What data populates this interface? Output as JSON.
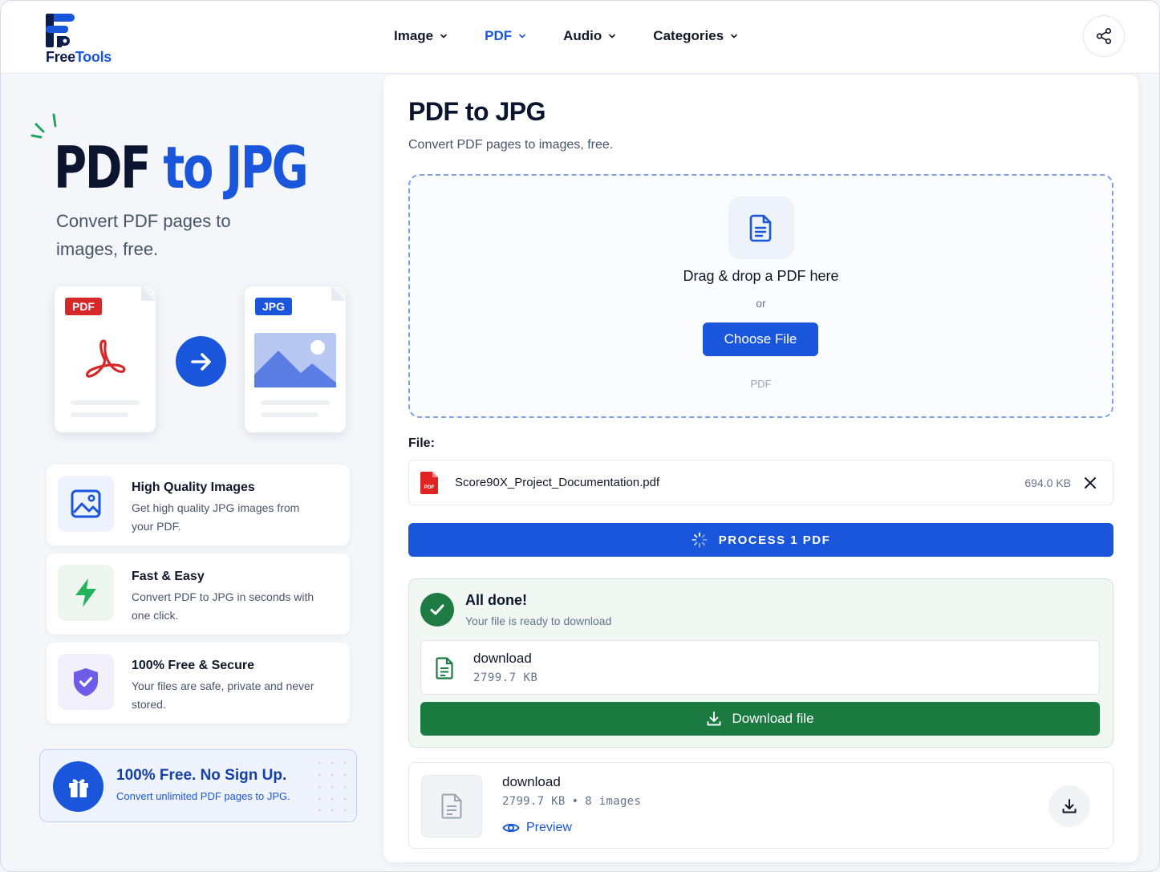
{
  "brand": {
    "name_part1": "Free",
    "name_part2": "Tools",
    "accent": "#1a56db"
  },
  "nav": {
    "items": [
      {
        "label": "Image",
        "active": false
      },
      {
        "label": "PDF",
        "active": true
      },
      {
        "label": "Audio",
        "active": false
      },
      {
        "label": "Categories",
        "active": false
      }
    ],
    "share_icon": "share-icon"
  },
  "hero": {
    "title_part1": "PDF",
    "title_part2": "to JPG",
    "subtitle": "Convert PDF pages to images, free.",
    "from_badge": "PDF",
    "to_badge": "JPG"
  },
  "features": [
    {
      "title": "High Quality Images",
      "desc": "Get high quality JPG images from your PDF.",
      "icon": "image-icon"
    },
    {
      "title": "Fast & Easy",
      "desc": "Convert PDF to JPG in seconds with one click.",
      "icon": "lightning-icon"
    },
    {
      "title": "100% Free & Secure",
      "desc": "Your files are safe, private and never stored.",
      "icon": "shield-icon"
    }
  ],
  "promo": {
    "title": "100% Free. No Sign Up.",
    "desc": "Convert unlimited PDF pages to JPG."
  },
  "tool": {
    "title": "PDF to JPG",
    "subtitle": "Convert PDF pages to images, free.",
    "dropzone": {
      "text": "Drag & drop a PDF here",
      "or": "or",
      "button": "Choose File",
      "accepted": "PDF"
    },
    "file_label": "File:",
    "file": {
      "name": "Score90X_Project_Documentation.pdf",
      "size": "694.0 KB"
    },
    "process_button": "PROCESS 1 PDF",
    "done": {
      "title": "All done!",
      "subtitle": "Your file is ready to download",
      "file_name": "download",
      "file_size": "2799.7 KB",
      "download_button": "Download file"
    },
    "result": {
      "name": "download",
      "size": "2799.7 KB",
      "sep": "•",
      "count": "8 images",
      "preview": "Preview"
    }
  }
}
